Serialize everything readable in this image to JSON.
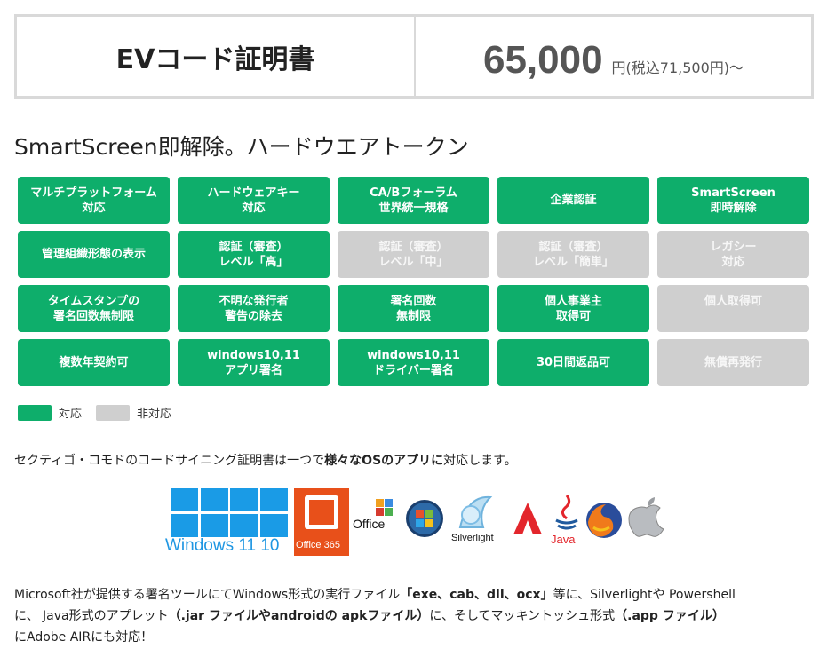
{
  "header": {
    "product_name": "EVコード証明書",
    "price_amount": "65,000",
    "price_suffix": "円(税込71,500円)～"
  },
  "subtitle": "SmartScreen即解除。ハードウエアトークン",
  "features": [
    {
      "label": "マルチプラットフォーム\n対応",
      "supported": true
    },
    {
      "label": "ハードウェアキー\n対応",
      "supported": true
    },
    {
      "label": "CA/Bフォーラム\n世界統一規格",
      "supported": true
    },
    {
      "label": "企業認証",
      "supported": true
    },
    {
      "label": "SmartScreen\n即時解除",
      "supported": true
    },
    {
      "label": "管理組織形態の表示",
      "supported": true
    },
    {
      "label": "認証（審査）\nレベル「高」",
      "supported": true
    },
    {
      "label": "認証（審査）\nレベル「中」",
      "supported": false
    },
    {
      "label": "認証（審査）\nレベル「簡単」",
      "supported": false
    },
    {
      "label": "レガシー\n対応",
      "supported": false
    },
    {
      "label": "タイムスタンプの\n署名回数無制限",
      "supported": true
    },
    {
      "label": "不明な発行者\n警告の除去",
      "supported": true
    },
    {
      "label": "署名回数\n無制限",
      "supported": true
    },
    {
      "label": "個人事業主\n取得可",
      "supported": true
    },
    {
      "label": "個人取得可",
      "supported": false
    },
    {
      "label": "複数年契約可",
      "supported": true
    },
    {
      "label": "windows10,11\nアプリ署名",
      "supported": true
    },
    {
      "label": "windows10,11\nドライバー署名",
      "supported": true
    },
    {
      "label": "30日間返品可",
      "supported": true
    },
    {
      "label": "無償再発行",
      "supported": false
    }
  ],
  "legend": {
    "supported_label": "対応",
    "unsupported_label": "非対応"
  },
  "intro": {
    "part1": "セクティゴ・コモドのコードサイニング証明書は一つで",
    "bold": "様々なOSのアプリ",
    "part2": "に",
    "part3": "対応します。"
  },
  "logos": {
    "windows_text": "Windows 11 10",
    "office365_text": "Office 365",
    "office_text": "Office",
    "silverlight_text": "Silverlight",
    "java_text": "Java"
  },
  "paragraph": {
    "t1": "Microsoft社が提供する署名ツールにてWindows形式の実行ファイル",
    "b1": "「exe、cab、dll、ocx」",
    "t2": "等に、Silverlightや Powershell",
    "t3": "に、 Java形式のアプレット",
    "b2": "（.jar ファイルやandroidの apkファイル）",
    "t4": "に、そしてマッキントッシュ形式",
    "b3": "（.app ファイル）",
    "t5": "にAdobe AIRにも対応！"
  },
  "colors": {
    "supported": "#0eae6b",
    "unsupported": "#cfcfcf"
  }
}
